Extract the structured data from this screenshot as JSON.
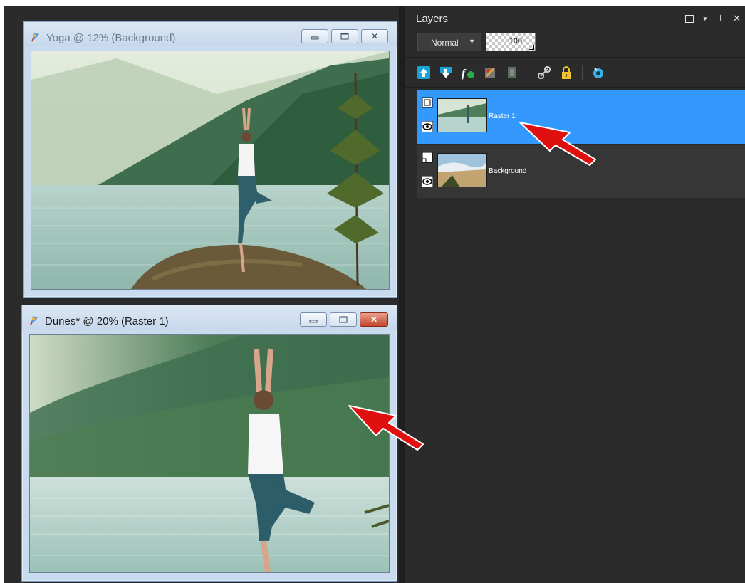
{
  "windows": {
    "top": {
      "title": "Yoga @  12% (Background)",
      "state": "inactive",
      "buttons": [
        "minimize",
        "maximize",
        "close"
      ]
    },
    "bottom": {
      "title": "Dunes* @  20% (Raster 1)",
      "state": "active",
      "buttons": [
        "minimize",
        "maximize",
        "close"
      ]
    }
  },
  "layers_panel": {
    "title": "Layers",
    "controls": [
      "restore-icon",
      "dropdown-icon",
      "pin-icon",
      "close-icon"
    ],
    "blend_mode": "Normal",
    "opacity": "100",
    "toolbar_icons": [
      "new-raster-layer-icon",
      "new-vector-layer-icon",
      "layer-style-icon",
      "mask-icon",
      "adjustment-layer-icon",
      "link-icon",
      "lock-icon",
      "eye-icon"
    ],
    "layers": [
      {
        "name": "Raster 1",
        "selected": true
      },
      {
        "name": "Background",
        "selected": false
      }
    ]
  },
  "colors": {
    "panel_bg": "#2b2b2b",
    "selection": "#3399ff",
    "annotation_arrow": "#e01010",
    "window_chrome": "#c9dbee"
  }
}
